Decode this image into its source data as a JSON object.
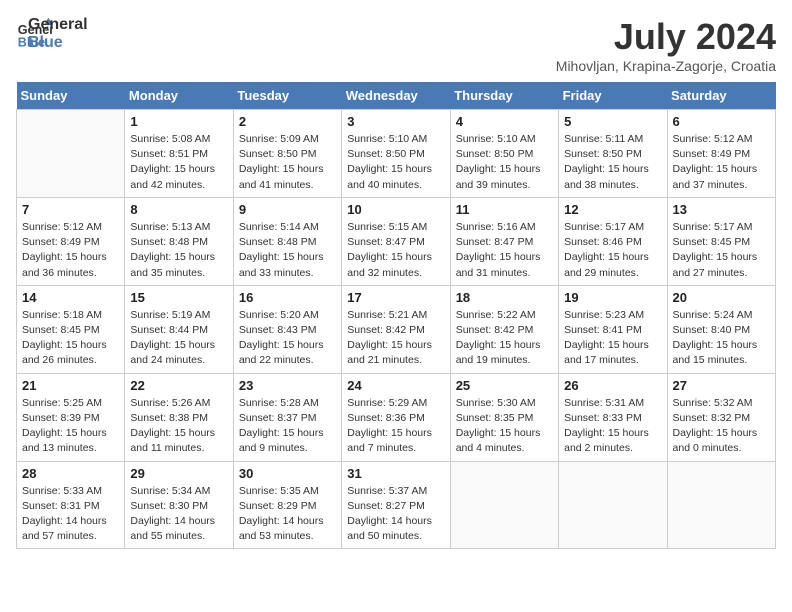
{
  "header": {
    "logo_line1": "General",
    "logo_line2": "Blue",
    "title": "July 2024",
    "location": "Mihovljan, Krapina-Zagorje, Croatia"
  },
  "weekdays": [
    "Sunday",
    "Monday",
    "Tuesday",
    "Wednesday",
    "Thursday",
    "Friday",
    "Saturday"
  ],
  "weeks": [
    [
      {
        "day": "",
        "text": ""
      },
      {
        "day": "1",
        "text": "Sunrise: 5:08 AM\nSunset: 8:51 PM\nDaylight: 15 hours\nand 42 minutes."
      },
      {
        "day": "2",
        "text": "Sunrise: 5:09 AM\nSunset: 8:50 PM\nDaylight: 15 hours\nand 41 minutes."
      },
      {
        "day": "3",
        "text": "Sunrise: 5:10 AM\nSunset: 8:50 PM\nDaylight: 15 hours\nand 40 minutes."
      },
      {
        "day": "4",
        "text": "Sunrise: 5:10 AM\nSunset: 8:50 PM\nDaylight: 15 hours\nand 39 minutes."
      },
      {
        "day": "5",
        "text": "Sunrise: 5:11 AM\nSunset: 8:50 PM\nDaylight: 15 hours\nand 38 minutes."
      },
      {
        "day": "6",
        "text": "Sunrise: 5:12 AM\nSunset: 8:49 PM\nDaylight: 15 hours\nand 37 minutes."
      }
    ],
    [
      {
        "day": "7",
        "text": "Sunrise: 5:12 AM\nSunset: 8:49 PM\nDaylight: 15 hours\nand 36 minutes."
      },
      {
        "day": "8",
        "text": "Sunrise: 5:13 AM\nSunset: 8:48 PM\nDaylight: 15 hours\nand 35 minutes."
      },
      {
        "day": "9",
        "text": "Sunrise: 5:14 AM\nSunset: 8:48 PM\nDaylight: 15 hours\nand 33 minutes."
      },
      {
        "day": "10",
        "text": "Sunrise: 5:15 AM\nSunset: 8:47 PM\nDaylight: 15 hours\nand 32 minutes."
      },
      {
        "day": "11",
        "text": "Sunrise: 5:16 AM\nSunset: 8:47 PM\nDaylight: 15 hours\nand 31 minutes."
      },
      {
        "day": "12",
        "text": "Sunrise: 5:17 AM\nSunset: 8:46 PM\nDaylight: 15 hours\nand 29 minutes."
      },
      {
        "day": "13",
        "text": "Sunrise: 5:17 AM\nSunset: 8:45 PM\nDaylight: 15 hours\nand 27 minutes."
      }
    ],
    [
      {
        "day": "14",
        "text": "Sunrise: 5:18 AM\nSunset: 8:45 PM\nDaylight: 15 hours\nand 26 minutes."
      },
      {
        "day": "15",
        "text": "Sunrise: 5:19 AM\nSunset: 8:44 PM\nDaylight: 15 hours\nand 24 minutes."
      },
      {
        "day": "16",
        "text": "Sunrise: 5:20 AM\nSunset: 8:43 PM\nDaylight: 15 hours\nand 22 minutes."
      },
      {
        "day": "17",
        "text": "Sunrise: 5:21 AM\nSunset: 8:42 PM\nDaylight: 15 hours\nand 21 minutes."
      },
      {
        "day": "18",
        "text": "Sunrise: 5:22 AM\nSunset: 8:42 PM\nDaylight: 15 hours\nand 19 minutes."
      },
      {
        "day": "19",
        "text": "Sunrise: 5:23 AM\nSunset: 8:41 PM\nDaylight: 15 hours\nand 17 minutes."
      },
      {
        "day": "20",
        "text": "Sunrise: 5:24 AM\nSunset: 8:40 PM\nDaylight: 15 hours\nand 15 minutes."
      }
    ],
    [
      {
        "day": "21",
        "text": "Sunrise: 5:25 AM\nSunset: 8:39 PM\nDaylight: 15 hours\nand 13 minutes."
      },
      {
        "day": "22",
        "text": "Sunrise: 5:26 AM\nSunset: 8:38 PM\nDaylight: 15 hours\nand 11 minutes."
      },
      {
        "day": "23",
        "text": "Sunrise: 5:28 AM\nSunset: 8:37 PM\nDaylight: 15 hours\nand 9 minutes."
      },
      {
        "day": "24",
        "text": "Sunrise: 5:29 AM\nSunset: 8:36 PM\nDaylight: 15 hours\nand 7 minutes."
      },
      {
        "day": "25",
        "text": "Sunrise: 5:30 AM\nSunset: 8:35 PM\nDaylight: 15 hours\nand 4 minutes."
      },
      {
        "day": "26",
        "text": "Sunrise: 5:31 AM\nSunset: 8:33 PM\nDaylight: 15 hours\nand 2 minutes."
      },
      {
        "day": "27",
        "text": "Sunrise: 5:32 AM\nSunset: 8:32 PM\nDaylight: 15 hours\nand 0 minutes."
      }
    ],
    [
      {
        "day": "28",
        "text": "Sunrise: 5:33 AM\nSunset: 8:31 PM\nDaylight: 14 hours\nand 57 minutes."
      },
      {
        "day": "29",
        "text": "Sunrise: 5:34 AM\nSunset: 8:30 PM\nDaylight: 14 hours\nand 55 minutes."
      },
      {
        "day": "30",
        "text": "Sunrise: 5:35 AM\nSunset: 8:29 PM\nDaylight: 14 hours\nand 53 minutes."
      },
      {
        "day": "31",
        "text": "Sunrise: 5:37 AM\nSunset: 8:27 PM\nDaylight: 14 hours\nand 50 minutes."
      },
      {
        "day": "",
        "text": ""
      },
      {
        "day": "",
        "text": ""
      },
      {
        "day": "",
        "text": ""
      }
    ]
  ]
}
